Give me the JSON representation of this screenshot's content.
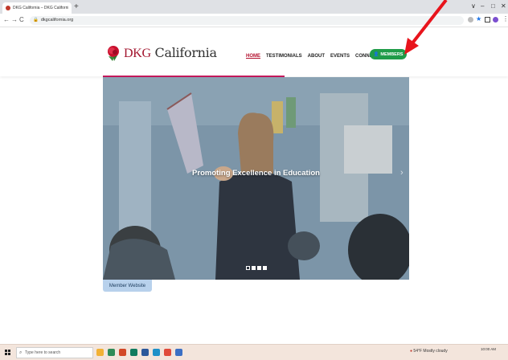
{
  "browser": {
    "tab_title": "DKG California – DKG California ×",
    "tab_close": "×",
    "new_tab": "+",
    "url": "dkgcalifornia.org",
    "window_controls": [
      "∨",
      "–",
      "□",
      "✕"
    ]
  },
  "site": {
    "logo_prefix": "DKG",
    "logo_suffix": " California",
    "nav": [
      {
        "label": "HOME",
        "active": true
      },
      {
        "label": "TESTIMONIALS"
      },
      {
        "label": "ABOUT"
      },
      {
        "label": "EVENTS"
      },
      {
        "label": "CONNECT"
      }
    ],
    "members_button": "MEMBERS",
    "hero_caption": "Promoting Excellence in Education",
    "member_website_tab": "Member Website",
    "colors": {
      "brand_red": "#a3162f",
      "members_green": "#1f9c49",
      "accent_pink": "#c2185b"
    }
  },
  "taskbar": {
    "search_placeholder": "Type here to search",
    "weather": "54°F  Mostly cloudy",
    "time": "10:00 AM"
  }
}
